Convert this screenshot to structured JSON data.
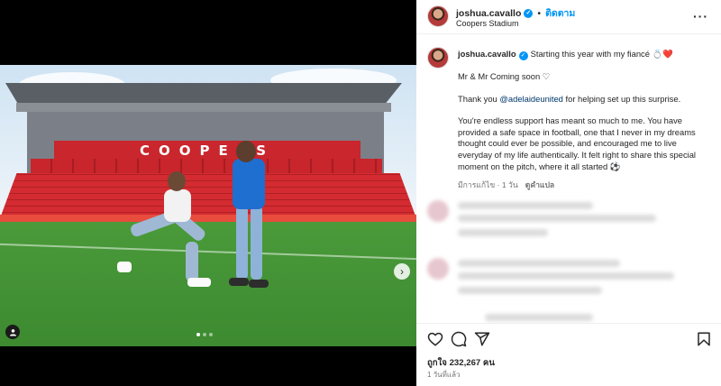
{
  "post": {
    "username": "joshua.cavallo",
    "follow_label": "ติดตาม",
    "separator": "•",
    "location": "Coopers Stadium",
    "more_label": "···",
    "verified_mark": "✓"
  },
  "media": {
    "stand_sign_text": "COOPERS",
    "next_icon": "chevron-right-icon",
    "next_symbol": "›",
    "carousel_dots": 3,
    "active_dot": 0
  },
  "caption": {
    "line1": "Starting this year with my fiancé",
    "line1_emoji": "💍❤️",
    "para2": "Mr & Mr Coming soon",
    "para2_emoji": "♡",
    "para3_prefix": "Thank you ",
    "para3_mention": "@adelaideunited",
    "para3_suffix": " for helping set up this surprise.",
    "para4": "You're endless support has meant so much to me. You have provided a safe space in football, one that I never in my dreams thought could ever be possible, and encouraged me to live everyday of my life authentically. It felt right to share this special moment on the pitch, where it all started",
    "para4_emoji": "⚽",
    "edited_time": "มีการแก้ไข · 1 วัน",
    "see_translation": "ดูคำแปล"
  },
  "footer": {
    "likes_label": "ถูกใจ 232,267 คน",
    "timestamp": "1 วันที่แล้ว"
  },
  "colors": {
    "accent": "#0095f6",
    "mention": "#00376b",
    "muted": "#737373",
    "text": "#262626"
  }
}
